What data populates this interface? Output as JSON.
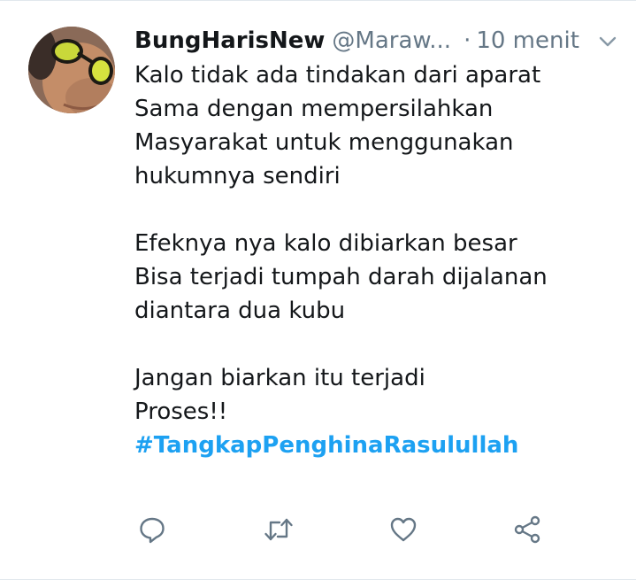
{
  "tweet": {
    "display_name": "BungHarisNew",
    "handle": "@Maraw...",
    "separator": "·",
    "time": "10 menit",
    "lines": [
      "Kalo tidak ada tindakan dari aparat",
      "Sama dengan mempersilahkan",
      "Masyarakat untuk menggunakan",
      "hukumnya sendiri",
      "",
      "Efeknya nya kalo dibiarkan besar",
      "Bisa terjadi tumpah darah dijalanan",
      "diantara dua kubu",
      "",
      "Jangan biarkan itu terjadi",
      "Proses!!"
    ],
    "hashtag": "#TangkapPenghinaRasulullah"
  },
  "icons": {
    "menu": "chevron-down-icon",
    "reply": "reply-icon",
    "retweet": "retweet-icon",
    "like": "heart-icon",
    "share": "share-icon"
  },
  "colors": {
    "text": "#14171a",
    "secondary": "#657786",
    "link": "#1da1f2"
  }
}
